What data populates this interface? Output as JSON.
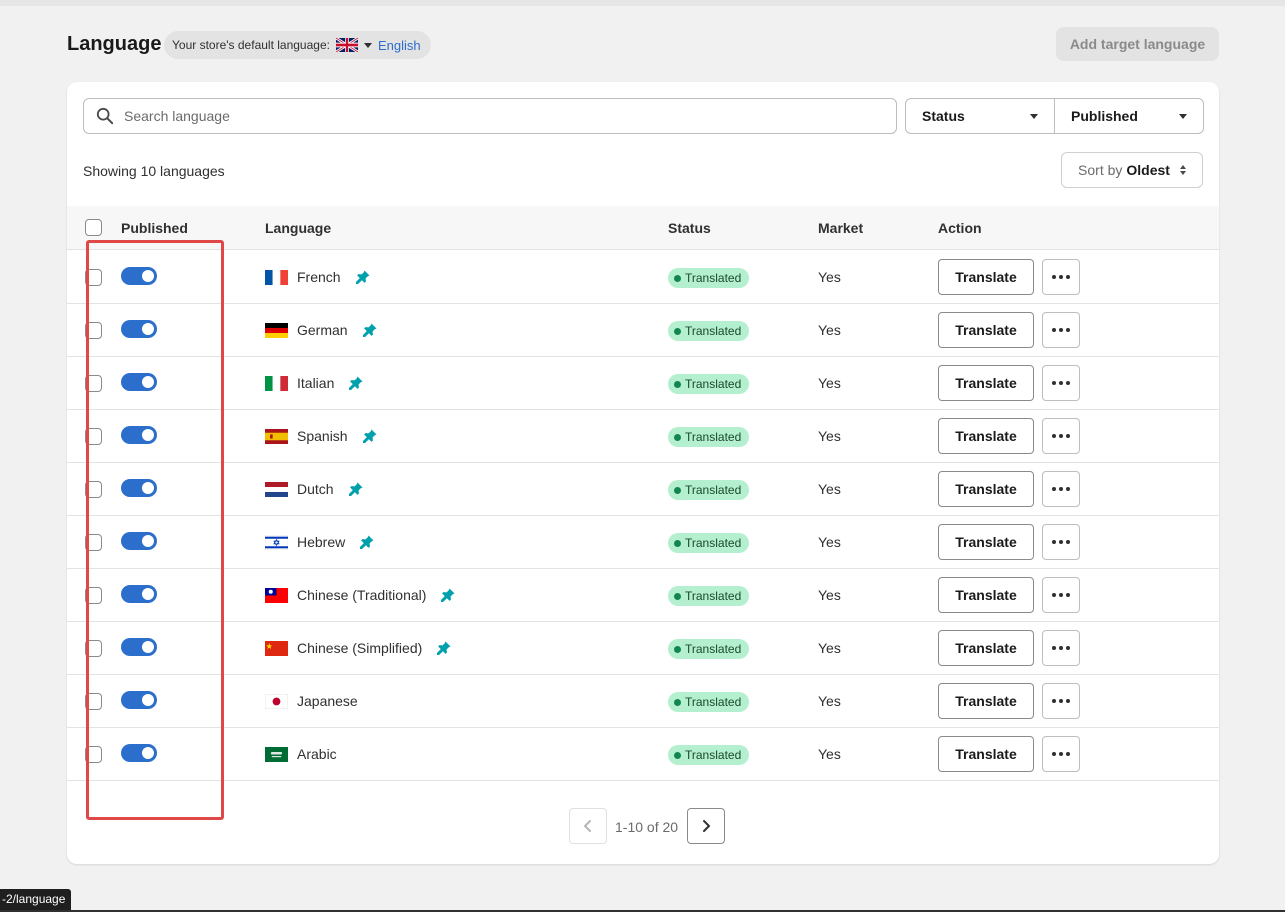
{
  "header": {
    "title": "Language",
    "default_label": "Your store's default language:",
    "default_language": "English",
    "default_flag": "uk-flag-icon",
    "add_button": "Add target language"
  },
  "toolbar": {
    "search_placeholder": "Search language",
    "status_filter": "Status",
    "published_filter": "Published",
    "showing": "Showing 10 languages",
    "sort_prefix": "Sort by",
    "sort_value": "Oldest"
  },
  "columns": {
    "published": "Published",
    "language": "Language",
    "status": "Status",
    "market": "Market",
    "action": "Action"
  },
  "rows": [
    {
      "language": "French",
      "flag": "fr",
      "pinned": true,
      "status": "Translated",
      "market": "Yes",
      "published": true,
      "action": "Translate"
    },
    {
      "language": "German",
      "flag": "de",
      "pinned": true,
      "status": "Translated",
      "market": "Yes",
      "published": true,
      "action": "Translate"
    },
    {
      "language": "Italian",
      "flag": "it",
      "pinned": true,
      "status": "Translated",
      "market": "Yes",
      "published": true,
      "action": "Translate"
    },
    {
      "language": "Spanish",
      "flag": "es",
      "pinned": true,
      "status": "Translated",
      "market": "Yes",
      "published": true,
      "action": "Translate"
    },
    {
      "language": "Dutch",
      "flag": "nl",
      "pinned": true,
      "status": "Translated",
      "market": "Yes",
      "published": true,
      "action": "Translate"
    },
    {
      "language": "Hebrew",
      "flag": "il",
      "pinned": true,
      "status": "Translated",
      "market": "Yes",
      "published": true,
      "action": "Translate"
    },
    {
      "language": "Chinese (Traditional)",
      "flag": "tw",
      "pinned": true,
      "status": "Translated",
      "market": "Yes",
      "published": true,
      "action": "Translate"
    },
    {
      "language": "Chinese (Simplified)",
      "flag": "cn",
      "pinned": true,
      "status": "Translated",
      "market": "Yes",
      "published": true,
      "action": "Translate"
    },
    {
      "language": "Japanese",
      "flag": "jp",
      "pinned": false,
      "status": "Translated",
      "market": "Yes",
      "published": true,
      "action": "Translate"
    },
    {
      "language": "Arabic",
      "flag": "sa",
      "pinned": false,
      "status": "Translated",
      "market": "Yes",
      "published": true,
      "action": "Translate"
    }
  ],
  "pagination": {
    "range": "1-10 of 20"
  },
  "status_url": "-2/language",
  "colors": {
    "accent": "#2c6ecb",
    "pin": "#00a0ac",
    "badge_bg": "#b4f0cf",
    "badge_dot": "#13864f",
    "highlight": "#e04848"
  }
}
